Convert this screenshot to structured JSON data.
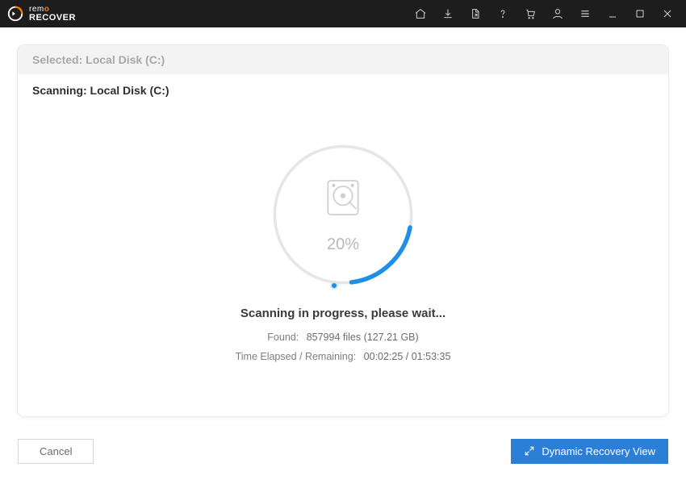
{
  "brand": {
    "line1": "rem",
    "accent": "o",
    "line2": "RECOVER"
  },
  "selected_label": "Selected: Local Disk (C:)",
  "scanning_label": "Scanning: Local Disk (C:)",
  "progress": {
    "percent": 20,
    "percent_text": "20%"
  },
  "status_msg": "Scanning in progress, please wait...",
  "found": {
    "label": "Found:",
    "value": "857994 files (127.21 GB)"
  },
  "time": {
    "label": "Time Elapsed / Remaining:",
    "value": "00:02:25 / 01:53:35"
  },
  "buttons": {
    "cancel": "Cancel",
    "drv": "Dynamic Recovery View"
  }
}
